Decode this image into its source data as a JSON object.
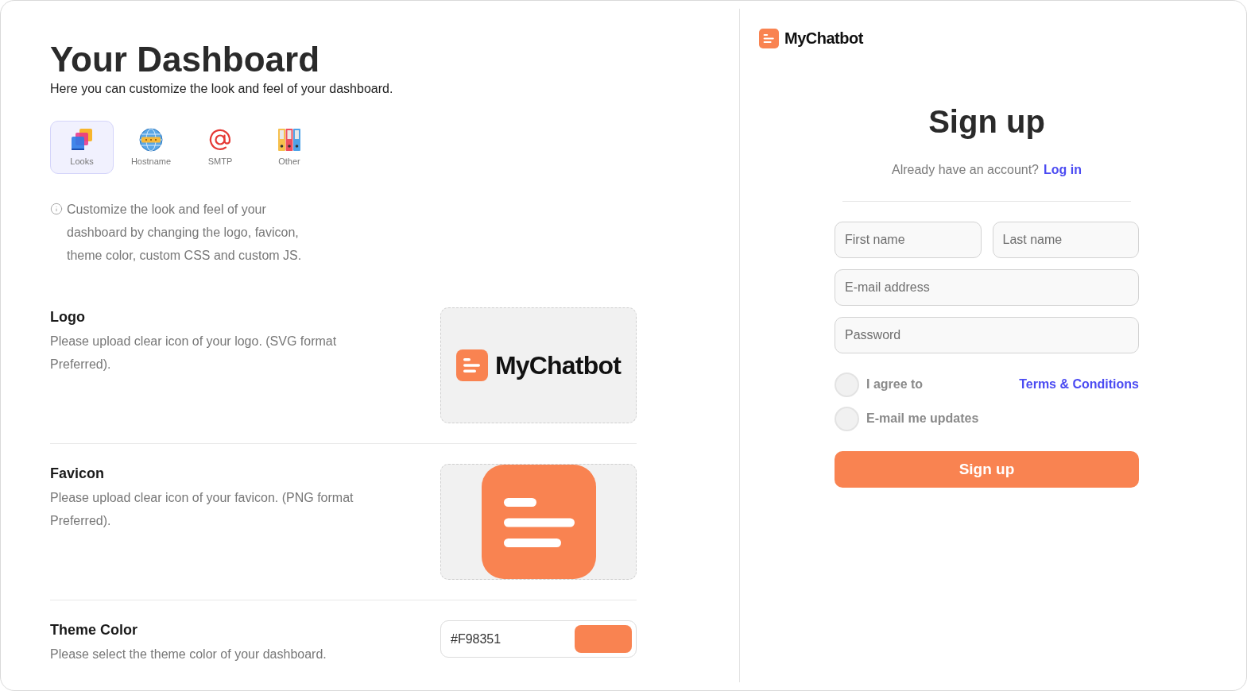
{
  "dashboard": {
    "title": "Your Dashboard",
    "subtitle": "Here you can customize the look and feel of your dashboard.",
    "tabs": [
      {
        "kind": "looks",
        "label": "Looks",
        "selected": true
      },
      {
        "kind": "hostname",
        "label": "Hostname",
        "selected": false
      },
      {
        "kind": "smtp",
        "label": "SMTP",
        "selected": false
      },
      {
        "kind": "other",
        "label": "Other",
        "selected": false
      }
    ],
    "info": "Customize the look and feel of your dashboard by changing the logo, favicon, theme color, custom CSS and custom JS.",
    "sections": [
      {
        "kind": "logo",
        "title": "Logo",
        "description": "Please upload clear icon of your logo. (SVG format Preferred).",
        "preview_text": "MyChatbot"
      },
      {
        "kind": "favicon",
        "title": "Favicon",
        "description": "Please upload clear icon of your favicon. (PNG format Preferred)."
      },
      {
        "kind": "color",
        "title": "Theme Color",
        "description": "Please select the theme color of your dashboard.",
        "value": "#F98351",
        "color": "#f98351"
      }
    ]
  },
  "signup": {
    "brand": "MyChatbot",
    "title": "Sign up",
    "prompt": "Already have an account?",
    "login_link": "Log in",
    "name_fields": [
      {
        "placeholder": "First name"
      },
      {
        "placeholder": "Last name"
      }
    ],
    "fields": [
      {
        "placeholder": "E-mail address"
      },
      {
        "placeholder": "Password"
      }
    ],
    "options": [
      {
        "label": "I agree to",
        "link": "Terms & Conditions",
        "checked": false
      },
      {
        "label": "E-mail me updates",
        "checked": false
      }
    ],
    "button": "Sign up"
  }
}
